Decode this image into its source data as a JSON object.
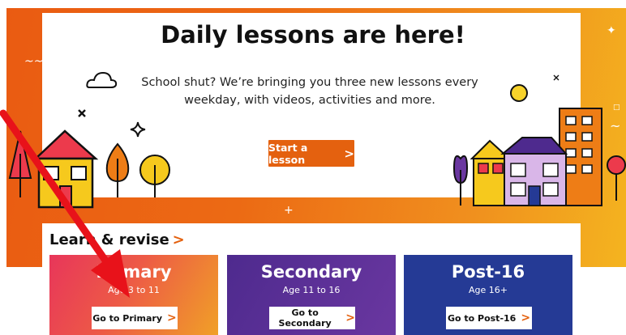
{
  "hero": {
    "title": "Daily lessons are here!",
    "subtitle": "School shut? We’re bringing you three new lessons every weekday, with videos, activities and more.",
    "cta_label": "Start a lesson",
    "cta_chevron": ">"
  },
  "revise": {
    "title": "Learn & revise",
    "arrow": ">"
  },
  "tiles": [
    {
      "name": "Primary",
      "age": "Age 3 to 11",
      "button": "Go to Primary",
      "chevron": ">"
    },
    {
      "name": "Secondary",
      "age": "Age 11 to 16",
      "button": "Go to Secondary",
      "chevron": ">"
    },
    {
      "name": "Post-16",
      "age": "Age 16+",
      "button": "Go to Post-16",
      "chevron": ">"
    }
  ],
  "colors": {
    "accent": "#e4610f",
    "hero_gradient_start": "#ea5b12",
    "hero_gradient_end": "#f4b41f",
    "primary_tile": "#e8365a",
    "secondary_tile": "#5a2e94",
    "post16_tile": "#253a95",
    "annotation_arrow": "#e8121a"
  },
  "icons": [
    "cloud-icon",
    "sparkle-icon",
    "cross-icon",
    "house-icon",
    "tree-icon",
    "building-icon",
    "chevron-right-icon",
    "annotation-arrow"
  ]
}
